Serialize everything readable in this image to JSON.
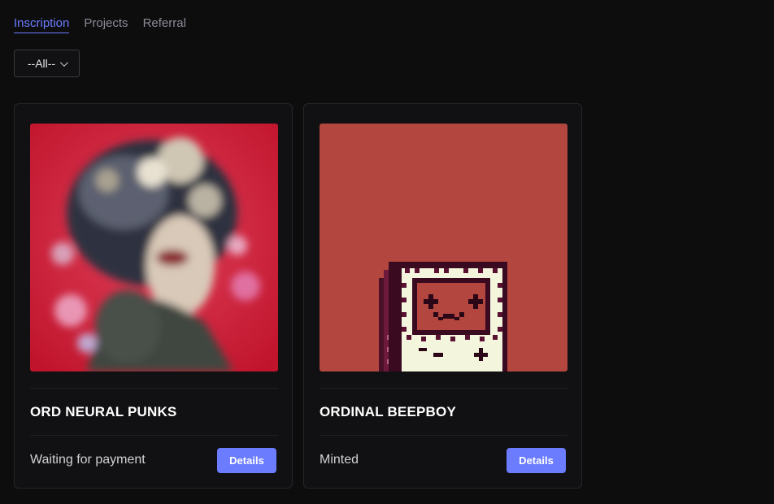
{
  "tabs": [
    {
      "label": "Inscription",
      "active": true
    },
    {
      "label": "Projects",
      "active": false
    },
    {
      "label": "Referral",
      "active": false
    }
  ],
  "filter": {
    "selected": "--All--"
  },
  "cards": [
    {
      "name": "ORD NEURAL PUNKS",
      "status": "Waiting for payment",
      "button": "Details",
      "image": "blurred-punk-portrait"
    },
    {
      "name": "ORDINAL BEEPBOY",
      "status": "Minted",
      "button": "Details",
      "image": "pixel-beepboy"
    }
  ],
  "colors": {
    "accent": "#6b7cff",
    "background": "#0d0d0e",
    "card": "#111113",
    "beepboy_bg": "#b3473f"
  }
}
